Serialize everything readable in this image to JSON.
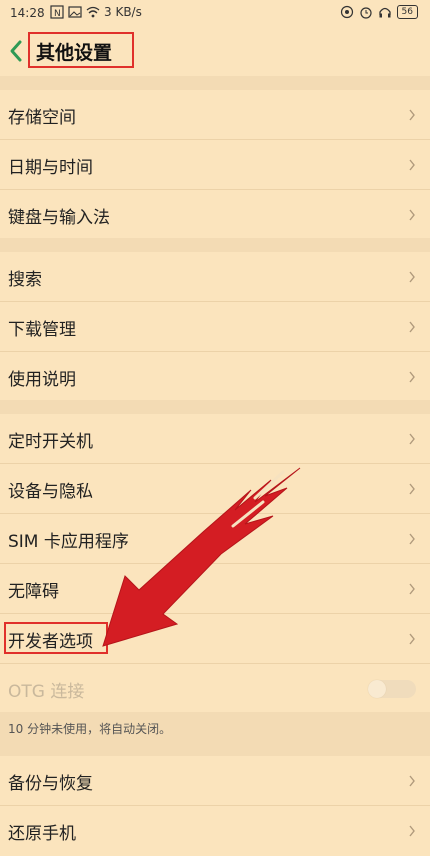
{
  "status": {
    "time": "14:28",
    "net_speed": "3 KB/s",
    "battery": "56"
  },
  "header": {
    "title": "其他设置"
  },
  "groups": {
    "g1": [
      "存储空间",
      "日期与时间",
      "键盘与输入法"
    ],
    "g2": [
      "搜索",
      "下载管理",
      "使用说明"
    ],
    "g3": [
      "定时开关机",
      "设备与隐私",
      "SIM 卡应用程序",
      "无障碍",
      "开发者选项",
      "OTG 连接"
    ],
    "g4": [
      "备份与恢复",
      "还原手机"
    ]
  },
  "otg_note": "10 分钟未使用，将自动关闭。",
  "colors": {
    "background": "#fbe4bd",
    "accent_green": "#2f9a55",
    "highlight_red": "#e0302b",
    "arrow_red": "#d41d23"
  }
}
